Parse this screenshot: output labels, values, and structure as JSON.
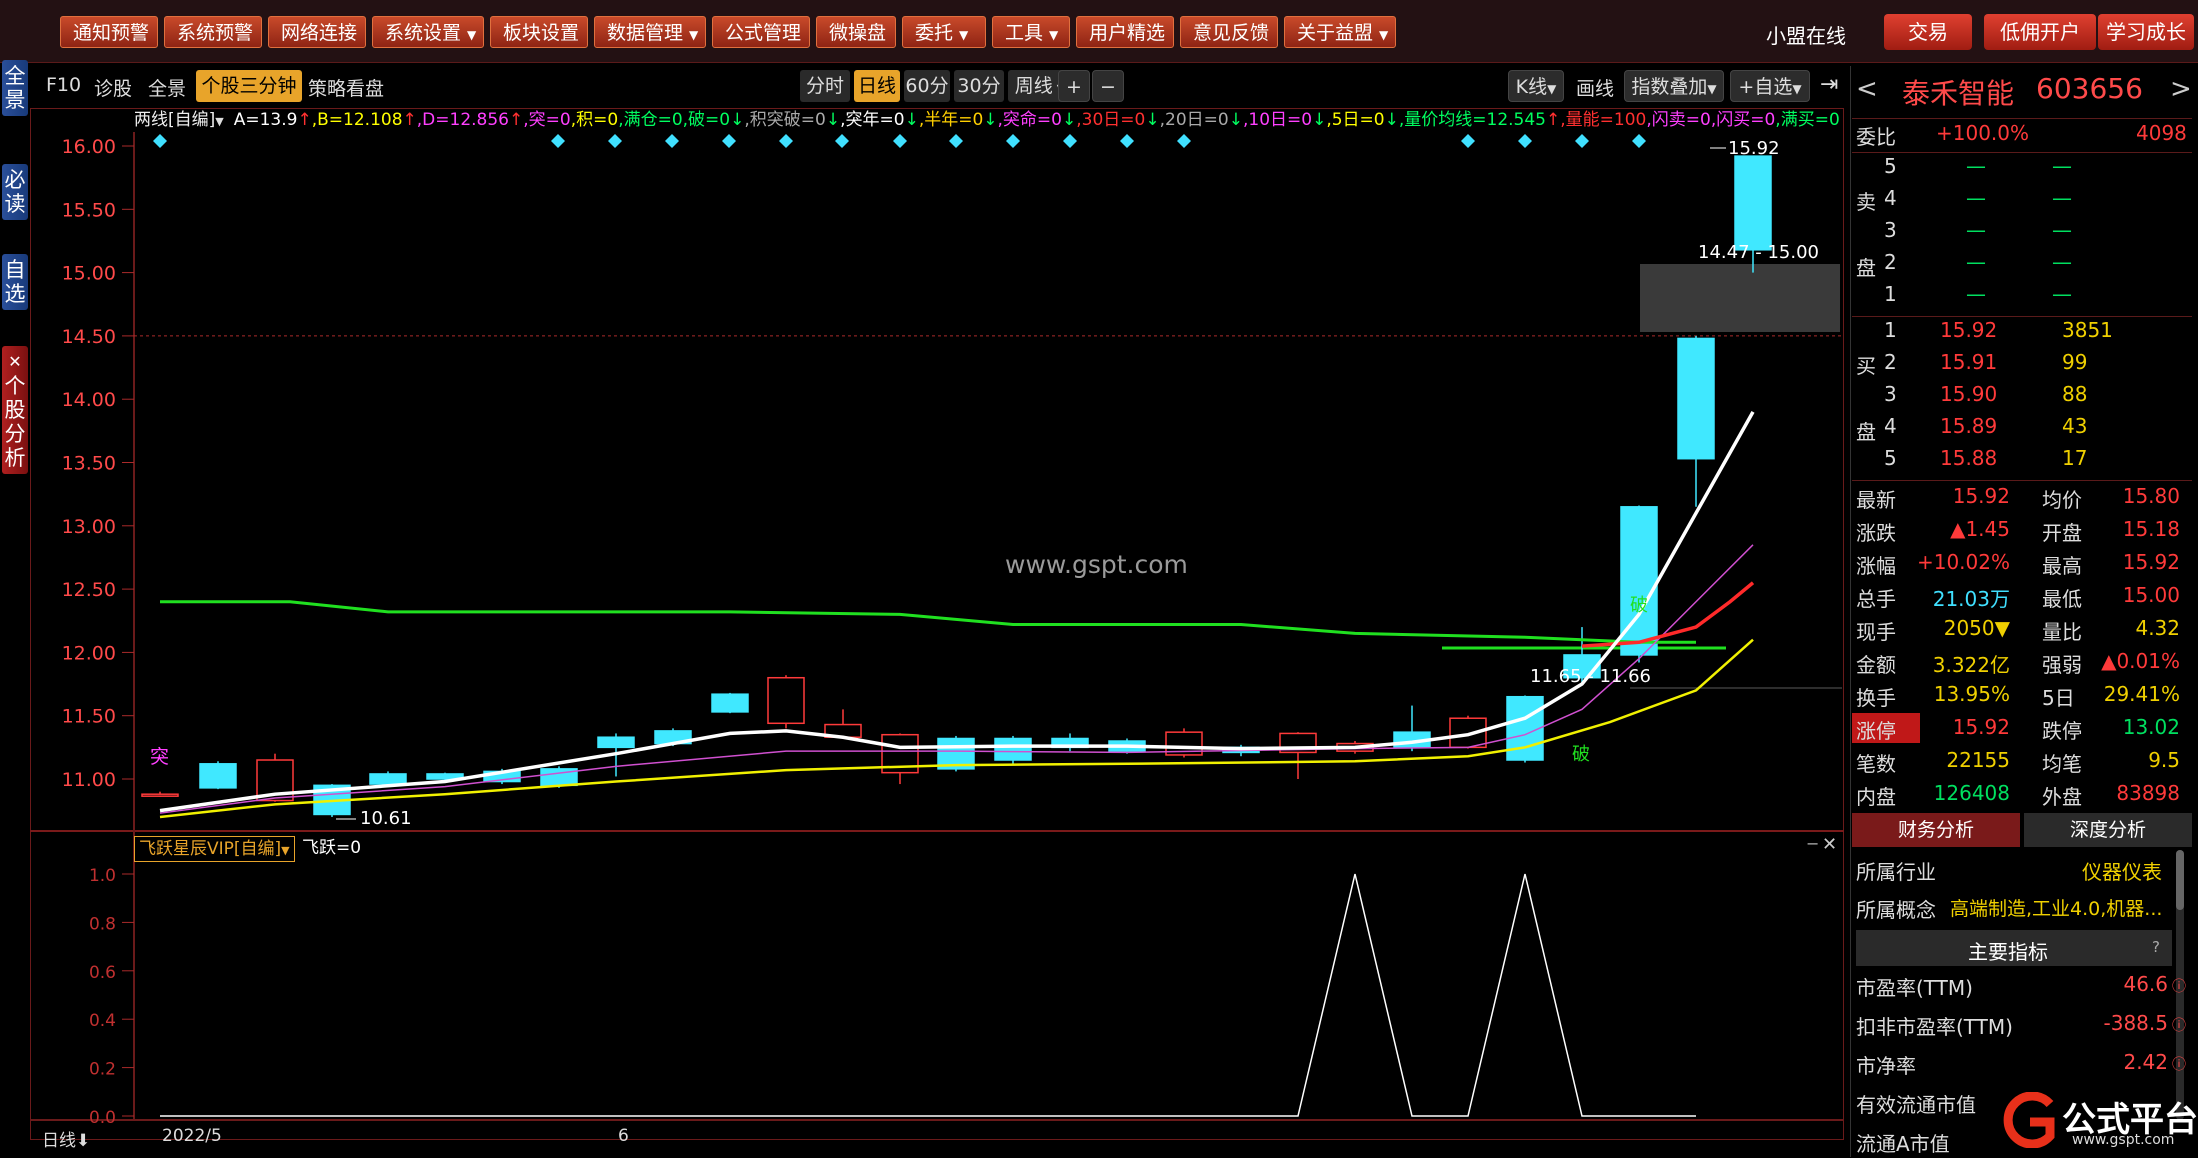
{
  "top_menu": [
    {
      "label": "通知预警",
      "dropdown": false
    },
    {
      "label": "系统预警",
      "dropdown": false
    },
    {
      "label": "网络连接",
      "dropdown": false
    },
    {
      "label": "系统设置",
      "dropdown": true
    },
    {
      "label": "板块设置",
      "dropdown": false
    },
    {
      "label": "数据管理",
      "dropdown": true
    },
    {
      "label": "公式管理",
      "dropdown": false
    },
    {
      "label": "微操盘",
      "dropdown": false
    },
    {
      "label": "委托",
      "dropdown": true
    },
    {
      "label": "工具",
      "dropdown": true
    },
    {
      "label": "用户精选",
      "dropdown": false
    },
    {
      "label": "意见反馈",
      "dropdown": false
    },
    {
      "label": "关于益盟",
      "dropdown": true
    }
  ],
  "top_right": {
    "online": "小盟在线",
    "trade": "交易",
    "open_account": "低佣开户",
    "learn": "学习成长"
  },
  "left_tabs": [
    "全景",
    "必读",
    "自选",
    "个股分析"
  ],
  "toolbar": {
    "f10": "F10",
    "diagnose": "诊股",
    "panorama": "全景",
    "three_min": "个股三分钟",
    "strategy": "策略看盘",
    "periods": [
      "分时",
      "日线",
      "60分",
      "30分",
      "周线"
    ],
    "active_period": "日线",
    "plus": "+",
    "minus": "−",
    "kline": "K线",
    "draw": "画线",
    "index_overlay": "指数叠加",
    "add_watch": "+自选"
  },
  "indicator": {
    "name": "两线[自编]",
    "items": [
      {
        "text": "A=13.9",
        "color": "#ffffff"
      },
      {
        "text": "↑",
        "color": "#ff3030"
      },
      {
        "text": ",B=12.108",
        "color": "#ffff00"
      },
      {
        "text": "↑",
        "color": "#ff3030"
      },
      {
        "text": ",D=12.856",
        "color": "#ff40ff"
      },
      {
        "text": "↑",
        "color": "#ff3030"
      },
      {
        "text": ",突=0",
        "color": "#ff40ff"
      },
      {
        "text": ",积=0",
        "color": "#ffff00"
      },
      {
        "text": ",满仓=0",
        "color": "#00ff60"
      },
      {
        "text": ",破=0",
        "color": "#00ff60"
      },
      {
        "text": "↓",
        "color": "#00ff60"
      },
      {
        "text": ",积突破=0",
        "color": "#aaaaaa"
      },
      {
        "text": "↓",
        "color": "#00ff60"
      },
      {
        "text": ",突年=0",
        "color": "#ffffff"
      },
      {
        "text": "↓",
        "color": "#00ff60"
      },
      {
        "text": ",半年=0",
        "color": "#ffd000"
      },
      {
        "text": "↓",
        "color": "#00ff60"
      },
      {
        "text": ",突命=0",
        "color": "#ff40ff"
      },
      {
        "text": "↓",
        "color": "#00ff60"
      },
      {
        "text": ",30日=0",
        "color": "#ff3030"
      },
      {
        "text": "↓",
        "color": "#00ff60"
      },
      {
        "text": ",20日=0",
        "color": "#aaaaaa"
      },
      {
        "text": "↓",
        "color": "#00ff60"
      },
      {
        "text": ",10日=0",
        "color": "#ff40ff"
      },
      {
        "text": "↓",
        "color": "#00ff60"
      },
      {
        "text": ",5日=0",
        "color": "#ffff00"
      },
      {
        "text": "↓",
        "color": "#00ff60"
      },
      {
        "text": ",量价均线=12.545",
        "color": "#00ff60"
      },
      {
        "text": "↑",
        "color": "#ff3030"
      },
      {
        "text": ",量能=100",
        "color": "#ff3030"
      },
      {
        "text": ",闪卖=0",
        "color": "#ff40ff"
      },
      {
        "text": ",闪买=0",
        "color": "#ff40ff"
      },
      {
        "text": ",满买=0",
        "color": "#00ff60"
      }
    ]
  },
  "main_chart": {
    "y_ticks": [
      "16.00",
      "15.50",
      "15.00",
      "14.50",
      "14.00",
      "13.50",
      "13.00",
      "12.50",
      "12.00",
      "11.50",
      "11.00"
    ],
    "y_values": [
      16.0,
      15.5,
      15.0,
      14.5,
      14.0,
      13.5,
      13.0,
      12.5,
      12.0,
      11.5,
      11.0
    ],
    "high_label": "15.92",
    "range_label_top": "14.47 - 15.00",
    "range_label_mid": "11.65 - 11.66",
    "low_label": "10.61",
    "signal_tu": "突",
    "signal_po": "破",
    "watermark": "www.gspt.com"
  },
  "sub_chart": {
    "name": "飞跃星辰VIP[自编]",
    "value_text": "飞跃=0",
    "y_ticks": [
      "1.0",
      "0.8",
      "0.6",
      "0.4",
      "0.2",
      "0.0"
    ]
  },
  "x_axis": {
    "period_label": "日线",
    "labels": [
      "2022/5",
      "6"
    ]
  },
  "stock": {
    "name": "泰禾智能",
    "code": "603656",
    "prev": "<",
    "next": ">"
  },
  "order_book": {
    "weibi_label": "委比",
    "weibi": "+100.0%",
    "weicha": "4098",
    "sell_side_label": [
      "卖",
      "盘"
    ],
    "buy_side_label": [
      "买",
      "盘"
    ],
    "asks": [
      {
        "level": "5",
        "price": "—",
        "vol": "—"
      },
      {
        "level": "4",
        "price": "—",
        "vol": "—"
      },
      {
        "level": "3",
        "price": "—",
        "vol": "—"
      },
      {
        "level": "2",
        "price": "—",
        "vol": "—"
      },
      {
        "level": "1",
        "price": "—",
        "vol": "—"
      }
    ],
    "bids": [
      {
        "level": "1",
        "price": "15.92",
        "vol": "3851"
      },
      {
        "level": "2",
        "price": "15.91",
        "vol": "99"
      },
      {
        "level": "3",
        "price": "15.90",
        "vol": "88"
      },
      {
        "level": "4",
        "price": "15.89",
        "vol": "43"
      },
      {
        "level": "5",
        "price": "15.88",
        "vol": "17"
      }
    ]
  },
  "quote": [
    {
      "l1": "最新",
      "v1": "15.92",
      "c1": "red",
      "l2": "均价",
      "v2": "15.80",
      "c2": "red"
    },
    {
      "l1": "涨跌",
      "v1": "▲1.45",
      "c1": "red",
      "l2": "开盘",
      "v2": "15.18",
      "c2": "red"
    },
    {
      "l1": "涨幅",
      "v1": "+10.02%",
      "c1": "red",
      "l2": "最高",
      "v2": "15.92",
      "c2": "red"
    },
    {
      "l1": "总手",
      "v1": "21.03万",
      "c1": "cyn",
      "l2": "最低",
      "v2": "15.00",
      "c2": "red"
    },
    {
      "l1": "现手",
      "v1": "2050▼",
      "c1": "yel",
      "l2": "量比",
      "v2": "4.32",
      "c2": "yel"
    },
    {
      "l1": "金额",
      "v1": "3.322亿",
      "c1": "yel",
      "l2": "强弱",
      "v2": "▲0.01%",
      "c2": "red"
    },
    {
      "l1": "换手",
      "v1": "13.95%",
      "c1": "yel",
      "l2": "5日",
      "v2": "29.41%",
      "c2": "yel"
    },
    {
      "l1": "涨停",
      "v1": "15.92",
      "c1": "red",
      "l2": "跌停",
      "v2": "13.02",
      "c2": "grn"
    },
    {
      "l1": "笔数",
      "v1": "22155",
      "c1": "yel",
      "l2": "均笔",
      "v2": "9.5",
      "c2": "yel"
    },
    {
      "l1": "内盘",
      "v1": "126408",
      "c1": "grn",
      "l2": "外盘",
      "v2": "83898",
      "c2": "red"
    }
  ],
  "fin_tabs": [
    "财务分析",
    "深度分析"
  ],
  "fin": {
    "industry_label": "所属行业",
    "industry": "仪器仪表",
    "concept_label": "所属概念",
    "concept": "高端制造,工业4.0,机器...",
    "main_index": "主要指标",
    "help": "?",
    "rows": [
      {
        "label": "市盈率(TTM)",
        "value": "46.6"
      },
      {
        "label": "扣非市盈率(TTM)",
        "value": "-388.5"
      },
      {
        "label": "市净率",
        "value": "2.42"
      },
      {
        "label": "有效流通市值",
        "value": ""
      },
      {
        "label": "流通A市值",
        "value": ""
      }
    ]
  },
  "logo": {
    "text": "公式平台",
    "sub": "www.gspt.com"
  }
}
